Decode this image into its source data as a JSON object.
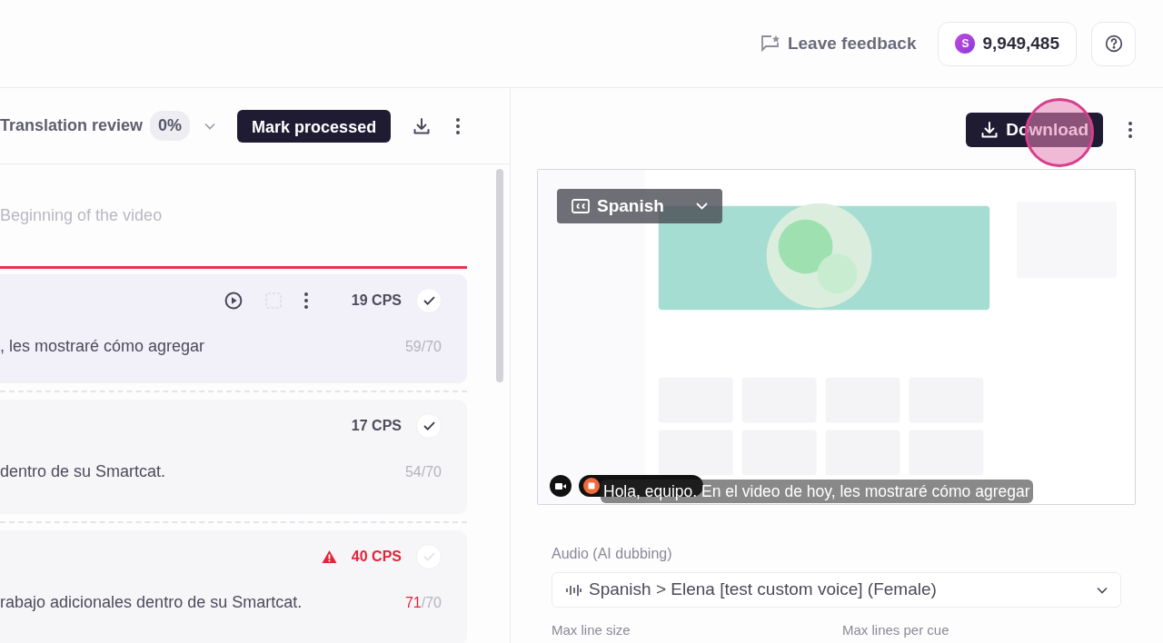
{
  "topbar": {
    "feedback": "Leave feedback",
    "balance_icon": "S",
    "balance": "9,949,485"
  },
  "editor": {
    "stage": "Translation review",
    "progress": "0%",
    "mark_button": "Mark processed",
    "start_label": "Beginning of the video",
    "segments": [
      {
        "cps": "19 CPS",
        "warning": false,
        "confirmed": true,
        "selected": true,
        "text": ", les mostraré cómo agregar",
        "chars": "59",
        "limit": "/70",
        "over": false
      },
      {
        "cps": "17 CPS",
        "warning": false,
        "confirmed": true,
        "selected": false,
        "text": "dentro de su Smartcat.",
        "chars": "54",
        "limit": "/70",
        "over": false
      },
      {
        "cps": "40 CPS",
        "warning": true,
        "confirmed": false,
        "selected": false,
        "text": "rabajo adicionales dentro de su Smartcat.",
        "chars": "71",
        "limit": "/70",
        "over": true
      }
    ]
  },
  "preview": {
    "download_button": "Download",
    "click_highlight": true,
    "video": {
      "kind": "picture",
      "caption_language": "Spanish",
      "subtitle": "Hola, equipo. En el video de hoy, les mostraré cómo agregar"
    },
    "audio_label": "Audio (AI dubbing)",
    "audio_value": "Spanish > Elena [test custom voice] (Female)",
    "settings": [
      "Max line size",
      "Max lines per cue"
    ]
  }
}
